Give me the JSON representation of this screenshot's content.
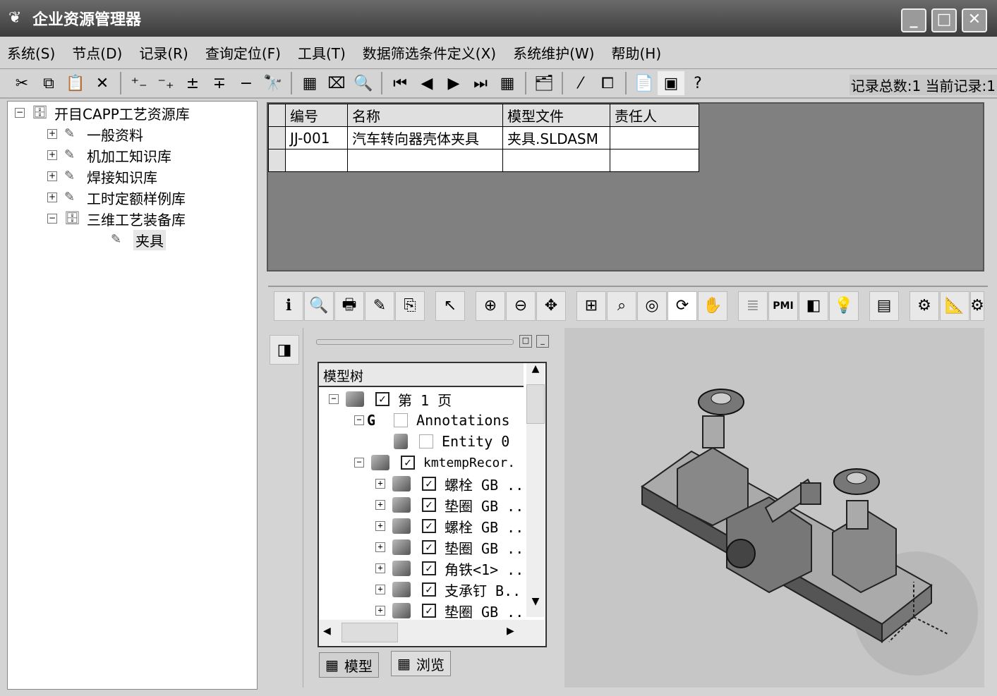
{
  "window": {
    "title": "企业资源管理器",
    "min": "_",
    "max": "□",
    "close": "✕"
  },
  "menu": [
    "系统(S)",
    "节点(D)",
    "记录(R)",
    "查询定位(F)",
    "工具(T)",
    "数据筛选条件定义(X)",
    "系统维护(W)",
    "帮助(H)"
  ],
  "status": "记录总数:1 当前记录:1",
  "left_tree": {
    "root": "开目CAPP工艺资源库",
    "children": [
      "一般资料",
      "机加工知识库",
      "焊接知识库",
      "工时定额样例库",
      "三维工艺装备库"
    ],
    "leaf": "夹具"
  },
  "grid": {
    "headers": [
      "编号",
      "名称",
      "模型文件",
      "责任人"
    ],
    "rows": [
      [
        "JJ-001",
        "汽车转向器壳体夹具",
        "夹具.SLDASM",
        ""
      ]
    ]
  },
  "model_tree": {
    "title": "模型树",
    "page": "第 1 页",
    "annotations": "Annotations",
    "entity": "Entity 0",
    "assembly": "kmtempRecor.",
    "items": [
      "螺栓 GB ..",
      "垫圈 GB ..",
      "螺栓 GB ..",
      "垫圈 GB ..",
      "角铁<1> ..",
      "支承钉 B..",
      "垫圈 GB .."
    ]
  },
  "tabs": {
    "model": "模型",
    "browse": "浏览"
  },
  "vtool_pmi": "PMI"
}
